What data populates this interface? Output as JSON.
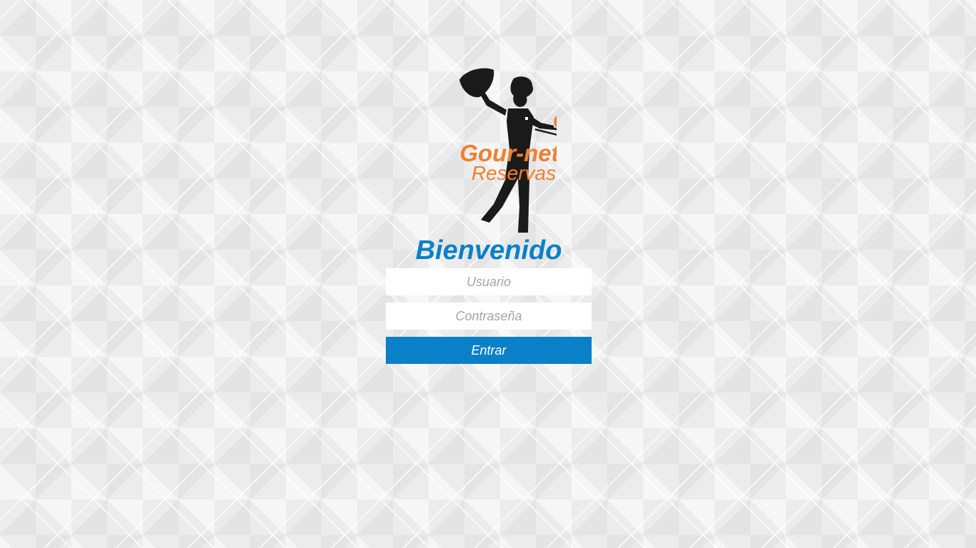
{
  "brand": {
    "logo_name": "Gour-net",
    "logo_subtitle": "Reservas",
    "logo_letter": "G",
    "colors": {
      "logo_orange": "#f07f2e",
      "silhouette": "#1a1a1a"
    }
  },
  "login": {
    "welcome": "Bienvenido",
    "username_placeholder": "Usuario",
    "password_placeholder": "Contraseña",
    "submit_label": "Entrar"
  },
  "theme": {
    "accent": "#0a80c8",
    "background": "#ececec"
  }
}
